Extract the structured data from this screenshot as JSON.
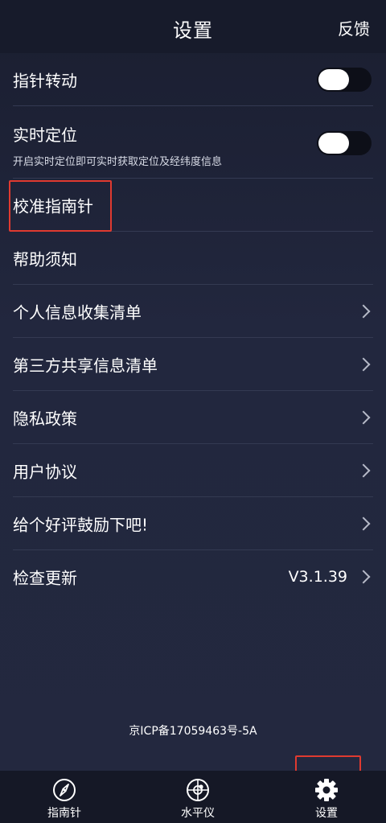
{
  "header": {
    "title": "设置",
    "action": "反馈"
  },
  "settings": {
    "pointer_rotation": {
      "label": "指针转动",
      "enabled": false
    },
    "realtime_location": {
      "label": "实时定位",
      "description": "开启实时定位即可实时获取定位及经纬度信息",
      "enabled": false
    },
    "calibrate": {
      "label": "校准指南针"
    },
    "help": {
      "label": "帮助须知"
    },
    "personal_info": {
      "label": "个人信息收集清单"
    },
    "third_party": {
      "label": "第三方共享信息清单"
    },
    "privacy": {
      "label": "隐私政策"
    },
    "agreement": {
      "label": "用户协议"
    },
    "rate": {
      "label": "给个好评鼓励下吧!"
    },
    "update": {
      "label": "检查更新",
      "version": "V3.1.39"
    }
  },
  "footer": {
    "icp": "京ICP备17059463号-5A"
  },
  "tabbar": {
    "items": [
      {
        "label": "指南针",
        "icon": "compass-icon",
        "active": false
      },
      {
        "label": "水平仪",
        "icon": "level-icon",
        "active": false
      },
      {
        "label": "设置",
        "icon": "gear-icon",
        "active": true
      }
    ]
  },
  "colors": {
    "background": "#20243a",
    "header": "#171b2b",
    "highlight": "#e03a30",
    "toggle_track": "#0d0f18"
  }
}
